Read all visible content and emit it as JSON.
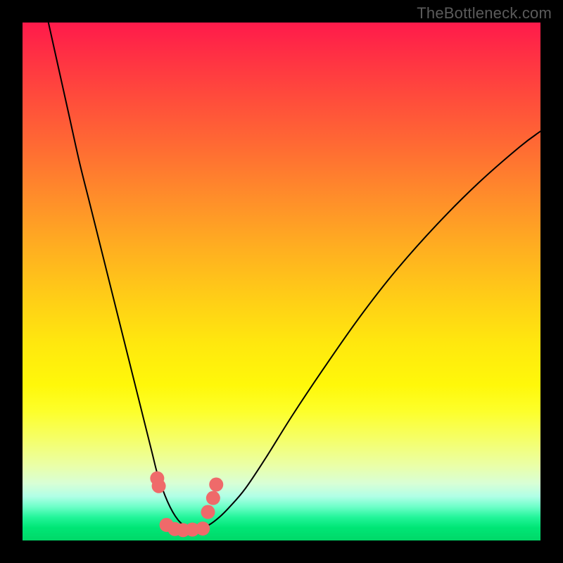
{
  "watermark": {
    "text": "TheBottleneck.com"
  },
  "chart_data": {
    "type": "line",
    "title": "",
    "xlabel": "",
    "ylabel": "",
    "xlim": [
      0,
      100
    ],
    "ylim": [
      0,
      100
    ],
    "grid": false,
    "legend": false,
    "background": {
      "kind": "vertical-gradient",
      "stops": [
        {
          "pos": 0,
          "color": "#ff1a4b"
        },
        {
          "pos": 0.5,
          "color": "#ffd016"
        },
        {
          "pos": 0.75,
          "color": "#fdff2a"
        },
        {
          "pos": 0.9,
          "color": "#d8ffd6"
        },
        {
          "pos": 1.0,
          "color": "#00d868"
        }
      ]
    },
    "series": [
      {
        "name": "bottleneck-curve",
        "color": "#000000",
        "stroke_width": 2,
        "x": [
          5,
          7,
          9,
          11,
          13,
          15,
          17,
          19,
          20.5,
          22,
          23.5,
          25,
          26,
          27,
          28,
          29,
          30,
          31,
          32,
          33,
          34,
          36,
          38,
          40,
          43,
          47,
          52,
          58,
          65,
          72,
          80,
          88,
          96,
          100
        ],
        "y": [
          100,
          91,
          82,
          73,
          65,
          57,
          49,
          41,
          35,
          29,
          23,
          17,
          13,
          10,
          7.5,
          5.5,
          4,
          3,
          2.2,
          2,
          2.2,
          3,
          4.5,
          6.5,
          10,
          16,
          24,
          33,
          43,
          52,
          61,
          69,
          76,
          79
        ]
      },
      {
        "name": "optimal-band-markers",
        "color": "#ef6a6a",
        "marker": "circle",
        "marker_size": 10,
        "x": [
          26.0,
          26.3,
          27.8,
          29.4,
          31.0,
          32.8,
          34.8,
          35.8,
          36.8,
          37.4
        ],
        "y": [
          12.0,
          10.5,
          3.0,
          2.2,
          2.0,
          2.1,
          2.3,
          5.5,
          8.2,
          10.8
        ]
      }
    ],
    "annotations": []
  }
}
